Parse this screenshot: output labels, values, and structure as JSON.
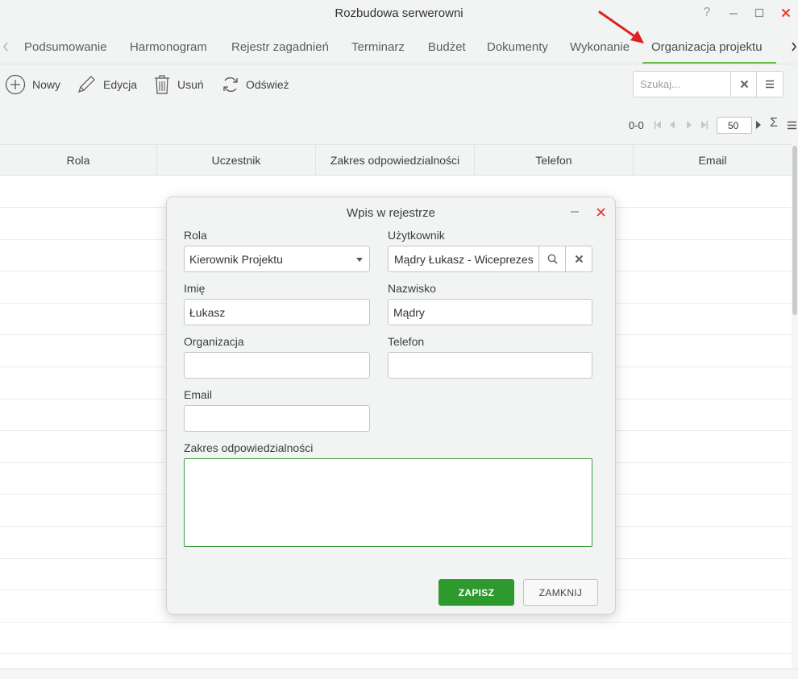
{
  "window": {
    "title": "Rozbudowa serwerowni",
    "help_glyph": "?"
  },
  "tabs": [
    {
      "label": "Podsumowanie"
    },
    {
      "label": "Harmonogram"
    },
    {
      "label": "Rejestr zagadnień"
    },
    {
      "label": "Terminarz"
    },
    {
      "label": "Budżet"
    },
    {
      "label": "Dokumenty"
    },
    {
      "label": "Wykonanie"
    },
    {
      "label": "Organizacja projektu",
      "active": true
    }
  ],
  "toolbar": {
    "new_label": "Nowy",
    "edit_label": "Edycja",
    "delete_label": "Usuń",
    "refresh_label": "Odśwież",
    "search_placeholder": "Szukaj..."
  },
  "pager": {
    "range": "0-0",
    "page_size": "50",
    "sum_glyph": "Σ"
  },
  "grid": {
    "columns": [
      "Rola",
      "Uczestnik",
      "Zakres odpowiedzialności",
      "Telefon",
      "Email"
    ]
  },
  "dialog": {
    "title": "Wpis w rejestrze",
    "fields": {
      "role_label": "Rola",
      "role_value": "Kierownik Projektu",
      "user_label": "Użytkownik",
      "user_value": "Mądry Łukasz - Wiceprezes",
      "first_name_label": "Imię",
      "first_name_value": "Łukasz",
      "last_name_label": "Nazwisko",
      "last_name_value": "Mądry",
      "organization_label": "Organizacja",
      "organization_value": "",
      "phone_label": "Telefon",
      "phone_value": "",
      "email_label": "Email",
      "email_value": "",
      "scope_label": "Zakres odpowiedzialności",
      "scope_value": ""
    },
    "save_label": "ZAPISZ",
    "close_label": "ZAMKNIJ"
  },
  "colors": {
    "accent_green": "#2e9a2e",
    "tab_underline": "#6abf4b",
    "close_red": "#e53935",
    "annotation_arrow": "#e02020"
  }
}
